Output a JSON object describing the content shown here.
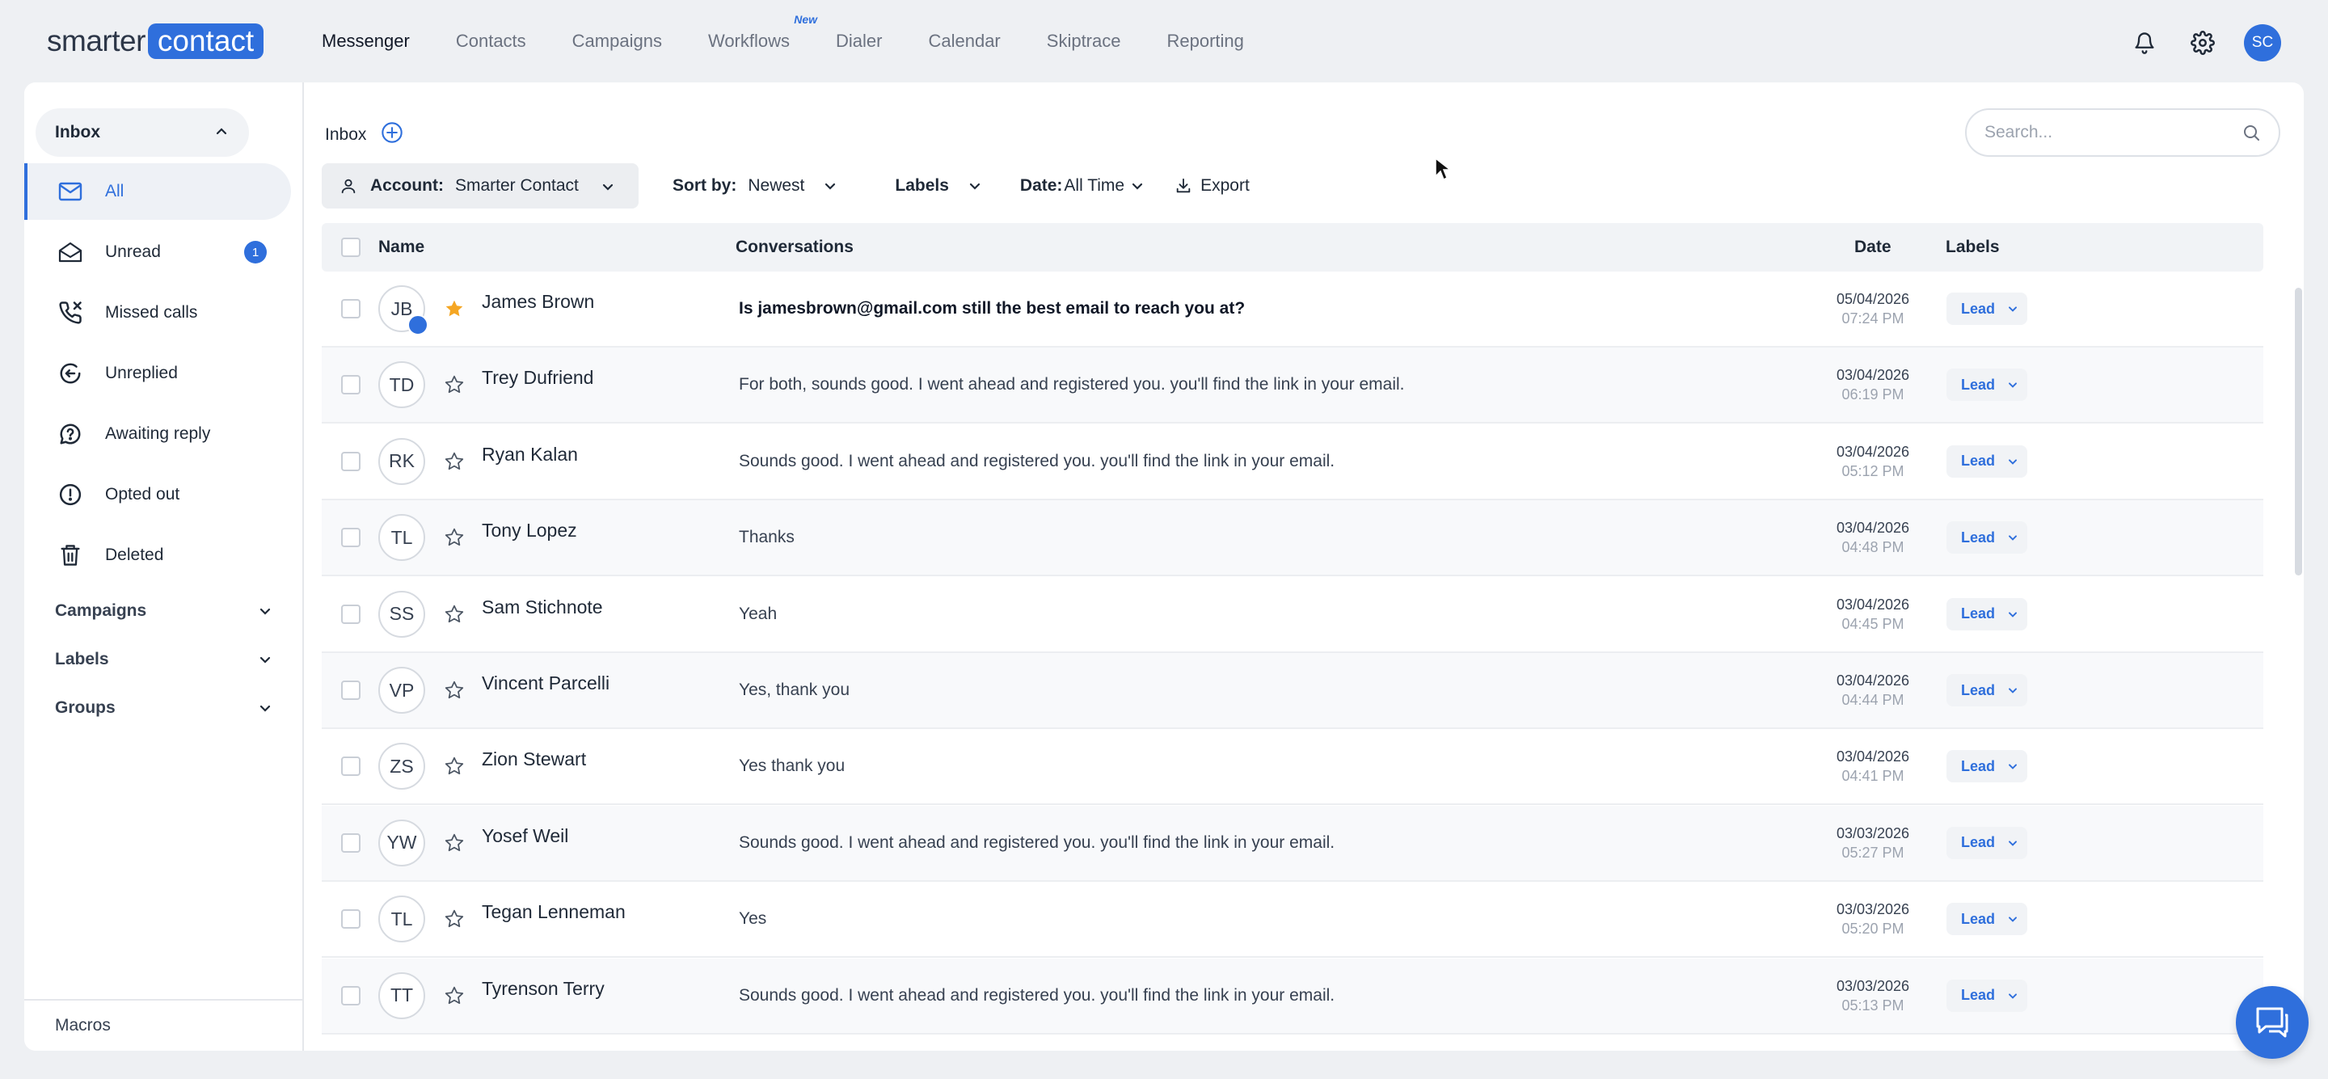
{
  "brand": {
    "logo_left": "smarter",
    "logo_right": "contact",
    "accent": "#2f6fdc"
  },
  "nav": {
    "items": [
      {
        "label": "Messenger",
        "active": true
      },
      {
        "label": "Contacts"
      },
      {
        "label": "Campaigns"
      },
      {
        "label": "Workflows",
        "badge": "New"
      },
      {
        "label": "Dialer"
      },
      {
        "label": "Calendar"
      },
      {
        "label": "Skiptrace"
      },
      {
        "label": "Reporting"
      }
    ],
    "user_initials": "SC",
    "icons": [
      "bell-icon",
      "gear-icon"
    ]
  },
  "sidebar": {
    "inbox_label": "Inbox",
    "items": [
      {
        "label": "All",
        "icon": "mail-icon",
        "active": true
      },
      {
        "label": "Unread",
        "icon": "envelope-open-icon",
        "count": "1"
      },
      {
        "label": "Missed calls",
        "icon": "missed-call-icon"
      },
      {
        "label": "Unreplied",
        "icon": "unreplied-icon"
      },
      {
        "label": "Awaiting reply",
        "icon": "question-icon"
      },
      {
        "label": "Opted out",
        "icon": "alert-circle-icon"
      },
      {
        "label": "Deleted",
        "icon": "trash-icon"
      }
    ],
    "groups": [
      "Campaigns",
      "Labels",
      "Groups"
    ],
    "macros_label": "Macros"
  },
  "main": {
    "breadcrumb": "Inbox",
    "search_placeholder": "Search...",
    "filters": {
      "account_label": "Account:",
      "account_value": "Smarter Contact",
      "sort_label": "Sort by:",
      "sort_value": "Newest",
      "labels_label": "Labels",
      "date_label": "Date:",
      "date_value": "All Time",
      "export_label": "Export"
    },
    "columns": {
      "name": "Name",
      "conversations": "Conversations",
      "date": "Date",
      "labels": "Labels"
    },
    "rows": [
      {
        "initials": "JB",
        "name": "James Brown",
        "starred": true,
        "unread": true,
        "message": "Is jamesbrown@gmail.com still the best email to reach you at?",
        "date": "05/04/2026",
        "time": "07:24 PM",
        "label": "Lead"
      },
      {
        "initials": "TD",
        "name": "Trey Dufriend",
        "message": "For both, sounds good. I went ahead and registered you. you'll find the link in your email.",
        "date": "03/04/2026",
        "time": "06:19 PM",
        "label": "Lead"
      },
      {
        "initials": "RK",
        "name": "Ryan Kalan",
        "message": "Sounds good. I went ahead and registered you. you'll find the link in your email.",
        "date": "03/04/2026",
        "time": "05:12 PM",
        "label": "Lead"
      },
      {
        "initials": "TL",
        "name": "Tony Lopez",
        "message": "Thanks",
        "date": "03/04/2026",
        "time": "04:48 PM",
        "label": "Lead"
      },
      {
        "initials": "SS",
        "name": "Sam Stichnote",
        "message": "Yeah",
        "date": "03/04/2026",
        "time": "04:45 PM",
        "label": "Lead"
      },
      {
        "initials": "VP",
        "name": "Vincent Parcelli",
        "message": "Yes, thank you",
        "date": "03/04/2026",
        "time": "04:44 PM",
        "label": "Lead"
      },
      {
        "initials": "ZS",
        "name": "Zion Stewart",
        "message": "Yes thank you",
        "date": "03/04/2026",
        "time": "04:41 PM",
        "label": "Lead"
      },
      {
        "initials": "YW",
        "name": "Yosef Weil",
        "message": "Sounds good. I went ahead and registered you. you'll find the link in your email.",
        "date": "03/03/2026",
        "time": "05:27 PM",
        "label": "Lead"
      },
      {
        "initials": "TL",
        "name": "Tegan Lenneman",
        "message": "Yes",
        "date": "03/03/2026",
        "time": "05:20 PM",
        "label": "Lead"
      },
      {
        "initials": "TT",
        "name": "Tyrenson Terry",
        "message": "Sounds good. I went ahead and registered you. you'll find the link in your email.",
        "date": "03/03/2026",
        "time": "05:13 PM",
        "label": "Lead"
      }
    ]
  }
}
